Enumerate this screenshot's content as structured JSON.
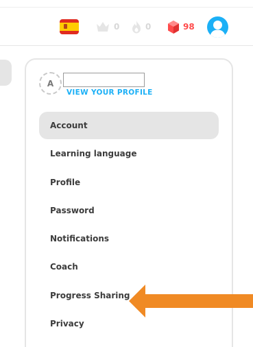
{
  "header": {
    "flag_icon": "spain-flag-icon",
    "crowns": {
      "icon": "crown-icon",
      "count": "0"
    },
    "streak": {
      "icon": "flame-icon",
      "count": "0"
    },
    "gems": {
      "icon": "gem-icon",
      "count": "98"
    },
    "avatar_icon": "user-avatar-icon"
  },
  "profile": {
    "avatar_initial": "A",
    "username_value": "",
    "view_profile_link": "VIEW YOUR PROFILE"
  },
  "menu": {
    "items": [
      {
        "label": "Account",
        "active": true
      },
      {
        "label": "Learning language",
        "active": false
      },
      {
        "label": "Profile",
        "active": false
      },
      {
        "label": "Password",
        "active": false
      },
      {
        "label": "Notifications",
        "active": false
      },
      {
        "label": "Coach",
        "active": false
      },
      {
        "label": "Progress Sharing",
        "active": false
      },
      {
        "label": "Privacy",
        "active": false
      }
    ]
  },
  "annotation": {
    "icon": "arrow-left-icon",
    "color": "#f08a24"
  },
  "colors": {
    "accent_blue": "#1cb0f6",
    "gem_red": "#ff4b4b",
    "inactive_gray": "#d8d8d8",
    "active_item_bg": "#e5e5e5"
  }
}
